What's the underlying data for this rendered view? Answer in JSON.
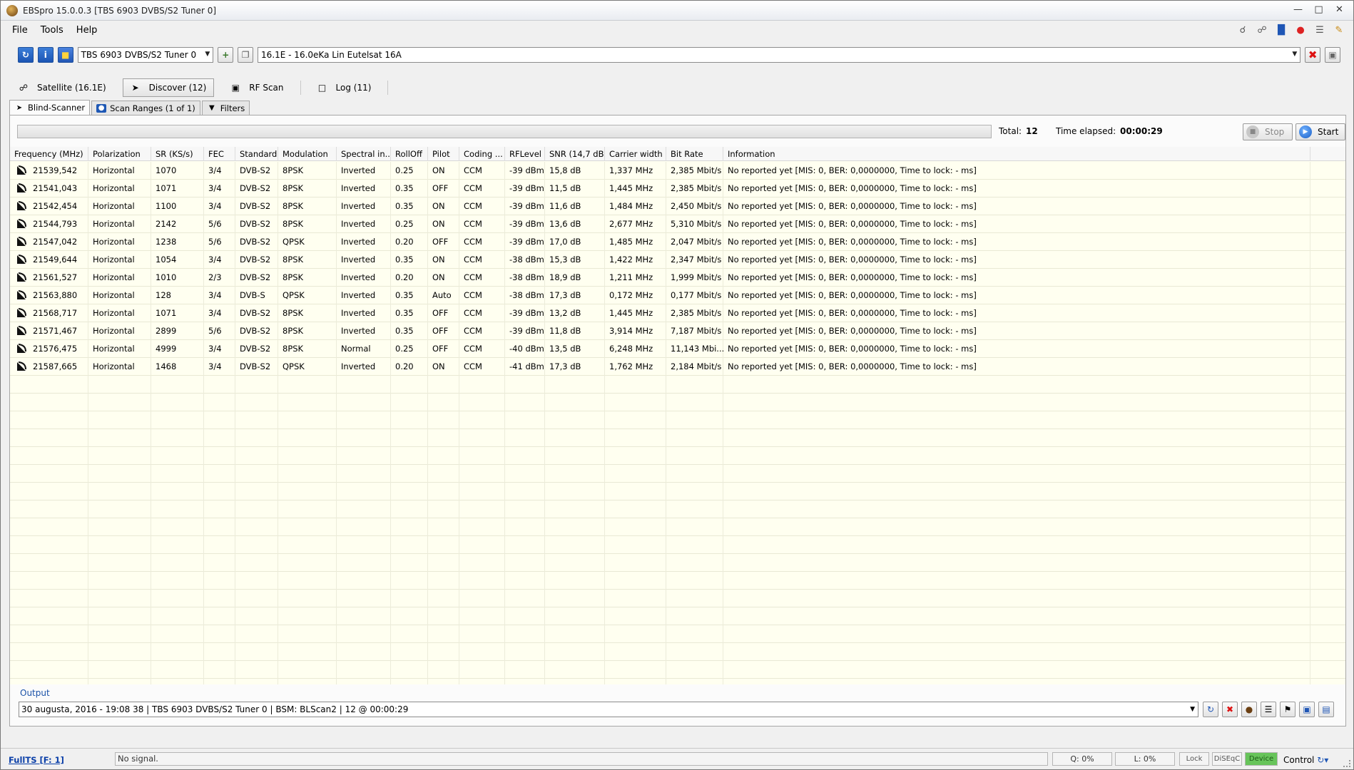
{
  "window": {
    "title": "EBSpro 15.0.0.3 [TBS 6903 DVBS/S2 Tuner 0]"
  },
  "menu": [
    "File",
    "Tools",
    "Help"
  ],
  "toolbar": {
    "tuner": "TBS 6903 DVBS/S2 Tuner 0",
    "satellite": "16.1E - 16.0eKa Lin Eutelsat 16A"
  },
  "main_tabs": [
    {
      "label": "Satellite (16.1E)",
      "icon": "satellite-dish-icon"
    },
    {
      "label": "Discover (12)",
      "icon": "discover-icon",
      "active": true
    },
    {
      "label": "RF Scan",
      "icon": "monitor-icon"
    },
    {
      "label": "Log (11)",
      "icon": "document-icon"
    }
  ],
  "sub_tabs": [
    {
      "label": "Blind-Scanner",
      "active": true
    },
    {
      "label": "Scan Ranges (1 of 1)"
    },
    {
      "label": "Filters"
    }
  ],
  "status": {
    "total_label": "Total:",
    "total_value": "12",
    "elapsed_label": "Time elapsed:",
    "elapsed_value": "00:00:29",
    "stop_label": "Stop",
    "start_label": "Start"
  },
  "table": {
    "columns": [
      "Frequency (MHz)",
      "Polarization",
      "SR (KS/s)",
      "FEC",
      "Standard",
      "Modulation",
      "Spectral in...",
      "RollOff",
      "Pilot",
      "Coding ...",
      "RFLevel",
      "SNR (14,7 dB)",
      "Carrier width",
      "Bit Rate",
      "Information"
    ],
    "rows": [
      [
        "21539,542",
        "Horizontal",
        "1070",
        "3/4",
        "DVB-S2",
        "8PSK",
        "Inverted",
        "0.25",
        "ON",
        "CCM",
        "-39 dBm",
        "15,8 dB",
        "1,337 MHz",
        "2,385 Mbit/s",
        "No reported yet [MIS: 0, BER: 0,0000000, Time to lock: - ms]"
      ],
      [
        "21541,043",
        "Horizontal",
        "1071",
        "3/4",
        "DVB-S2",
        "8PSK",
        "Inverted",
        "0.35",
        "OFF",
        "CCM",
        "-39 dBm",
        "11,5 dB",
        "1,445 MHz",
        "2,385 Mbit/s",
        "No reported yet [MIS: 0, BER: 0,0000000, Time to lock: - ms]"
      ],
      [
        "21542,454",
        "Horizontal",
        "1100",
        "3/4",
        "DVB-S2",
        "8PSK",
        "Inverted",
        "0.35",
        "ON",
        "CCM",
        "-39 dBm",
        "11,6 dB",
        "1,484 MHz",
        "2,450 Mbit/s",
        "No reported yet [MIS: 0, BER: 0,0000000, Time to lock: - ms]"
      ],
      [
        "21544,793",
        "Horizontal",
        "2142",
        "5/6",
        "DVB-S2",
        "8PSK",
        "Inverted",
        "0.25",
        "ON",
        "CCM",
        "-39 dBm",
        "13,6 dB",
        "2,677 MHz",
        "5,310 Mbit/s",
        "No reported yet [MIS: 0, BER: 0,0000000, Time to lock: - ms]"
      ],
      [
        "21547,042",
        "Horizontal",
        "1238",
        "5/6",
        "DVB-S2",
        "QPSK",
        "Inverted",
        "0.20",
        "OFF",
        "CCM",
        "-39 dBm",
        "17,0 dB",
        "1,485 MHz",
        "2,047 Mbit/s",
        "No reported yet [MIS: 0, BER: 0,0000000, Time to lock: - ms]"
      ],
      [
        "21549,644",
        "Horizontal",
        "1054",
        "3/4",
        "DVB-S2",
        "8PSK",
        "Inverted",
        "0.35",
        "ON",
        "CCM",
        "-38 dBm",
        "15,3 dB",
        "1,422 MHz",
        "2,347 Mbit/s",
        "No reported yet [MIS: 0, BER: 0,0000000, Time to lock: - ms]"
      ],
      [
        "21561,527",
        "Horizontal",
        "1010",
        "2/3",
        "DVB-S2",
        "8PSK",
        "Inverted",
        "0.20",
        "ON",
        "CCM",
        "-38 dBm",
        "18,9 dB",
        "1,211 MHz",
        "1,999 Mbit/s",
        "No reported yet [MIS: 0, BER: 0,0000000, Time to lock: - ms]"
      ],
      [
        "21563,880",
        "Horizontal",
        "128",
        "3/4",
        "DVB-S",
        "QPSK",
        "Inverted",
        "0.35",
        "Auto",
        "CCM",
        "-38 dBm",
        "17,3 dB",
        "0,172 MHz",
        "0,177 Mbit/s",
        "No reported yet [MIS: 0, BER: 0,0000000, Time to lock: - ms]"
      ],
      [
        "21568,717",
        "Horizontal",
        "1071",
        "3/4",
        "DVB-S2",
        "8PSK",
        "Inverted",
        "0.35",
        "OFF",
        "CCM",
        "-39 dBm",
        "13,2 dB",
        "1,445 MHz",
        "2,385 Mbit/s",
        "No reported yet [MIS: 0, BER: 0,0000000, Time to lock: - ms]"
      ],
      [
        "21571,467",
        "Horizontal",
        "2899",
        "5/6",
        "DVB-S2",
        "8PSK",
        "Inverted",
        "0.35",
        "OFF",
        "CCM",
        "-39 dBm",
        "11,8 dB",
        "3,914 MHz",
        "7,187 Mbit/s",
        "No reported yet [MIS: 0, BER: 0,0000000, Time to lock: - ms]"
      ],
      [
        "21576,475",
        "Horizontal",
        "4999",
        "3/4",
        "DVB-S2",
        "8PSK",
        "Normal",
        "0.25",
        "OFF",
        "CCM",
        "-40 dBm",
        "13,5 dB",
        "6,248 MHz",
        "11,143 Mbi...",
        "No reported yet [MIS: 0, BER: 0,0000000, Time to lock: - ms]"
      ],
      [
        "21587,665",
        "Horizontal",
        "1468",
        "3/4",
        "DVB-S2",
        "QPSK",
        "Inverted",
        "0.20",
        "ON",
        "CCM",
        "-41 dBm",
        "17,3 dB",
        "1,762 MHz",
        "2,184 Mbit/s",
        "No reported yet [MIS: 0, BER: 0,0000000, Time to lock: - ms]"
      ]
    ]
  },
  "output": {
    "label": "Output",
    "value": "30 augusta, 2016 - 19:08 38 | TBS 6903 DVBS/S2 Tuner 0 | BSM: BLScan2 | 12 @ 00:00:29"
  },
  "statusbar": {
    "fullts": "FullTS [F: 1]",
    "signal": "No signal.",
    "quality": "Q: 0%",
    "level": "L: 0%",
    "lock": "Lock",
    "diseqc": "DiSEqC",
    "device": "Device",
    "control": "Control"
  }
}
